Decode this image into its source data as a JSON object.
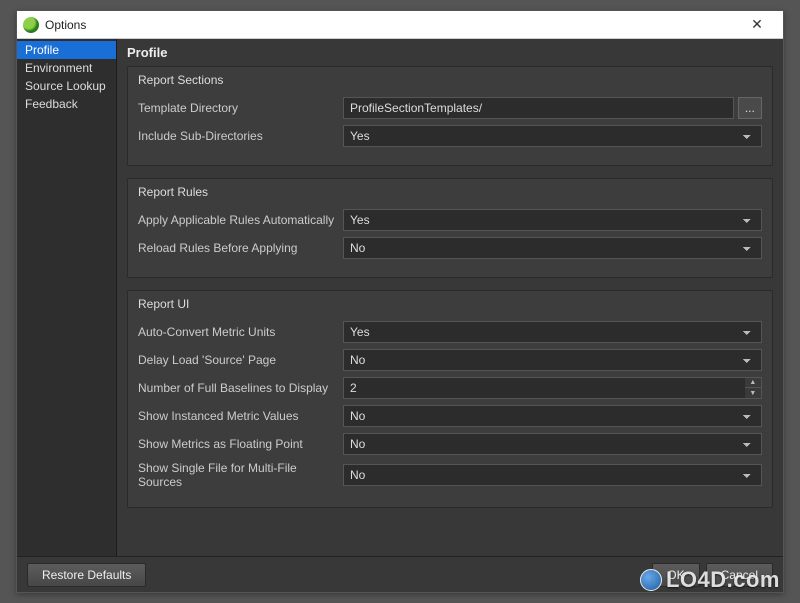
{
  "window": {
    "title": "Options"
  },
  "sidebar": {
    "items": [
      {
        "label": "Profile",
        "selected": true
      },
      {
        "label": "Environment",
        "selected": false
      },
      {
        "label": "Source Lookup",
        "selected": false
      },
      {
        "label": "Feedback",
        "selected": false
      }
    ]
  },
  "main": {
    "title": "Profile",
    "groups": {
      "report_sections": {
        "title": "Report Sections",
        "template_directory": {
          "label": "Template Directory",
          "value": "ProfileSectionTemplates/"
        },
        "include_subdirs": {
          "label": "Include Sub-Directories",
          "value": "Yes"
        },
        "browse_label": "..."
      },
      "report_rules": {
        "title": "Report Rules",
        "apply_auto": {
          "label": "Apply Applicable Rules Automatically",
          "value": "Yes"
        },
        "reload_before": {
          "label": "Reload Rules Before Applying",
          "value": "No"
        }
      },
      "report_ui": {
        "title": "Report UI",
        "auto_convert": {
          "label": "Auto-Convert Metric Units",
          "value": "Yes"
        },
        "delay_source": {
          "label": "Delay Load 'Source' Page",
          "value": "No"
        },
        "num_baselines": {
          "label": "Number of Full Baselines to Display",
          "value": "2"
        },
        "show_instanced": {
          "label": "Show Instanced Metric Values",
          "value": "No"
        },
        "show_floating": {
          "label": "Show Metrics as Floating Point",
          "value": "No"
        },
        "show_single": {
          "label": "Show Single File for Multi-File Sources",
          "value": "No"
        }
      }
    }
  },
  "footer": {
    "restore": "Restore Defaults",
    "ok": "OK",
    "cancel": "Cancel"
  },
  "select_options": {
    "yesno": [
      "Yes",
      "No"
    ]
  },
  "watermark": "LO4D.com"
}
